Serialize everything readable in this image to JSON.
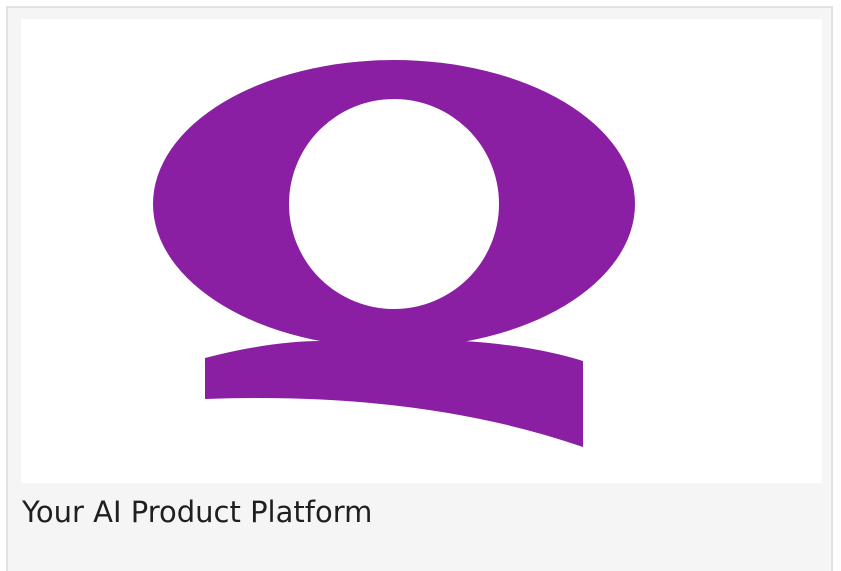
{
  "card": {
    "caption": "Your AI Product Platform"
  },
  "logo": {
    "icon": "q-logo-icon",
    "color": "#8a1fa3",
    "background": "#ffffff"
  }
}
